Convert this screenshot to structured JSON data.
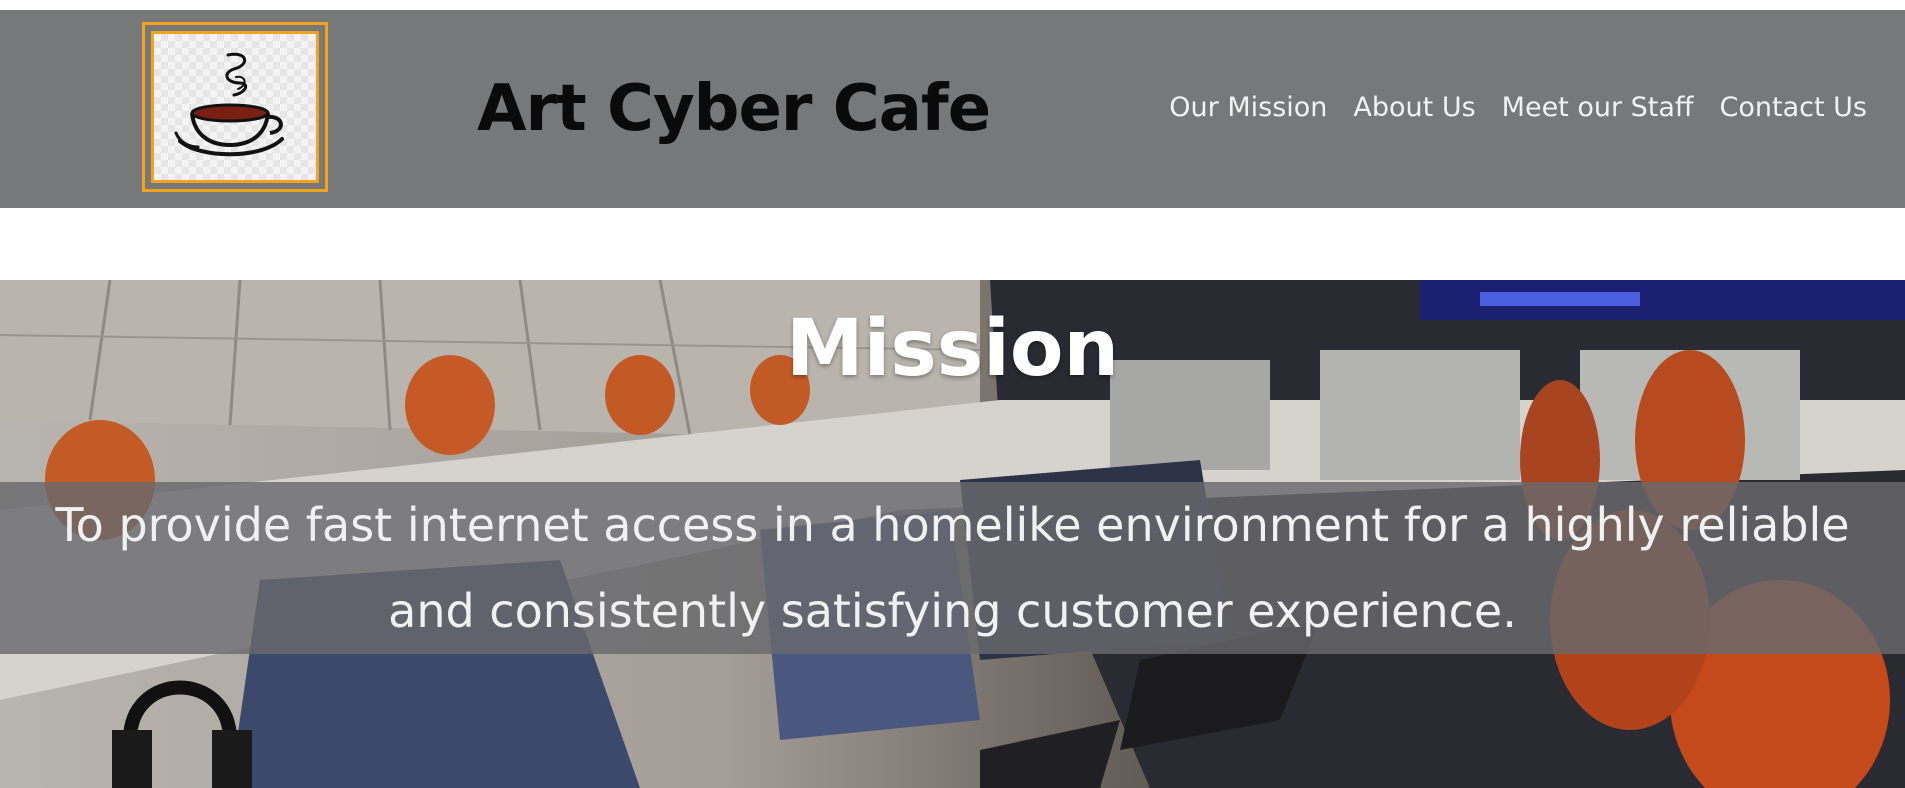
{
  "header": {
    "logo_icon": "coffee-cup-icon",
    "site_title": "Art Cyber Cafe"
  },
  "nav": {
    "items": [
      {
        "label": "Our Mission"
      },
      {
        "label": "About Us"
      },
      {
        "label": "Meet our Staff"
      },
      {
        "label": "Contact Us"
      }
    ]
  },
  "hero": {
    "title": "Mission",
    "text": "To provide fast internet access in a homelike environment for a highly reliable and consistently satisfying customer experience.",
    "background_image": "gaming-cafe-photo"
  },
  "colors": {
    "header_bg": "#77787a",
    "logo_border": "#f0a31b",
    "title_text": "#0a0a0a",
    "nav_text": "#f2f2f2"
  }
}
